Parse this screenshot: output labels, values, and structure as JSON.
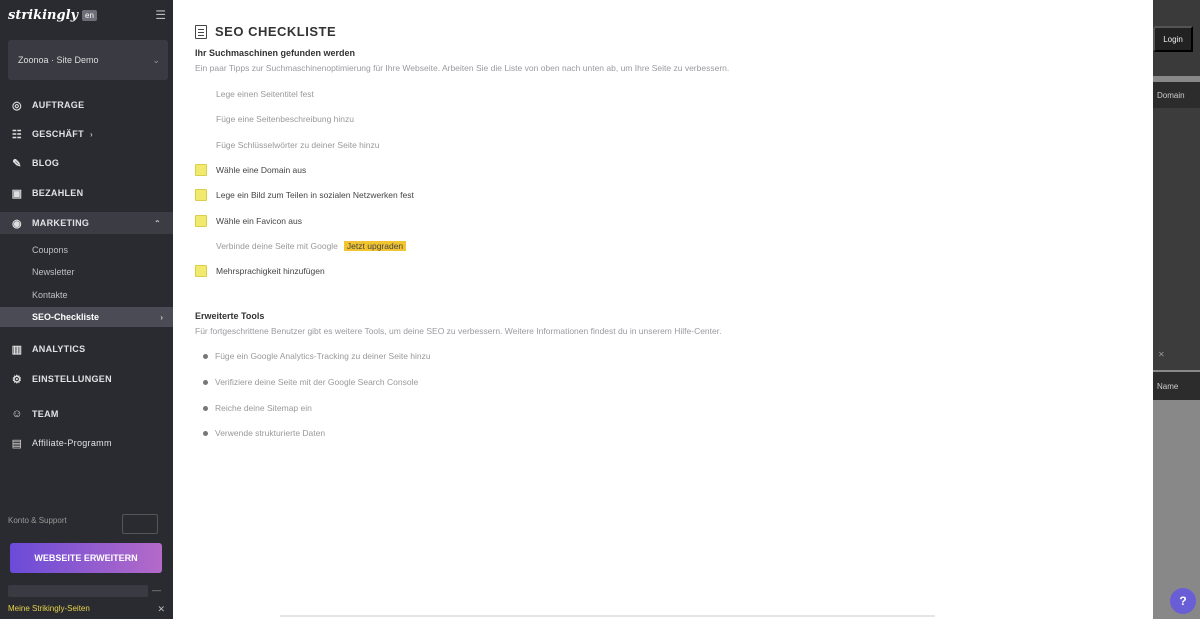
{
  "sidebar": {
    "logo": "strikingly",
    "logo_badge": "en",
    "menu_icon": "hamburger-icon",
    "site_name": "Zoonoa · Site Demo",
    "nav": [
      {
        "label": "AUFTRAGE",
        "icon": "target-icon"
      },
      {
        "label": "GESCHÄFT",
        "icon": "store-icon"
      },
      {
        "label": "BLOG",
        "icon": "blog-icon"
      },
      {
        "label": "BEZAHLEN",
        "icon": "wallet-icon"
      },
      {
        "label": "MARKETING",
        "icon": "megaphone-icon"
      }
    ],
    "marketing_sub": [
      "Coupons",
      "Newsletter",
      "Kontakte",
      "SEO-Checkliste"
    ],
    "nav_bottom": [
      {
        "label": "ANALYTICS",
        "icon": "chart-icon"
      },
      {
        "label": "EINSTELLUNGEN",
        "icon": "gear-icon"
      },
      {
        "label": "TEAM",
        "icon": "team-icon"
      },
      {
        "label": "Affiliate-Programm",
        "icon": "affiliate-icon"
      }
    ],
    "promo_text": "Konto & Support",
    "upgrade_label": "WEBSEITE ERWEITERN",
    "footer_text": "Meine Strikingly-Seiten"
  },
  "main": {
    "title": "SEO CHECKLISTE",
    "section1": {
      "title": "Ihr Suchmaschinen gefunden werden",
      "subtitle": "Ein paar Tipps zur Suchmaschinenoptimierung für Ihre Webseite. Arbeiten Sie die Liste von oben nach unten ab, um Ihre Seite zu verbessern."
    },
    "checklist": [
      {
        "text": "Lege einen Seitentitel fest",
        "done": true
      },
      {
        "text": "Füge eine Seitenbeschreibung hinzu",
        "done": true
      },
      {
        "text": "Füge Schlüsselwörter zu deiner Seite hinzu",
        "done": true
      },
      {
        "text": "Wähle eine Domain aus",
        "done": false
      },
      {
        "text": "Lege ein Bild zum Teilen in sozialen Netzwerken fest",
        "done": false
      },
      {
        "text": "Wähle ein Favicon aus",
        "done": false
      },
      {
        "text": "Verbinde deine Seite mit Google",
        "done": true,
        "tag": "Jetzt upgraden"
      },
      {
        "text": "Mehrsprachigkeit hinzufügen",
        "done": false
      }
    ],
    "section2": {
      "title": "Erweiterte Tools",
      "subtitle": "Für fortgeschrittene Benutzer gibt es weitere Tools, um deine SEO zu verbessern. Weitere Informationen findest du in unserem Hilfe-Center."
    },
    "tools": [
      "Füge ein Google Analytics-Tracking zu deiner Seite hinzu",
      "Verifiziere deine Seite mit der Google Search Console",
      "Reiche deine Sitemap ein",
      "Verwende strukturierte Daten"
    ]
  },
  "right_panel": {
    "button": "Login",
    "band1": "Domain",
    "band2": "Name"
  }
}
